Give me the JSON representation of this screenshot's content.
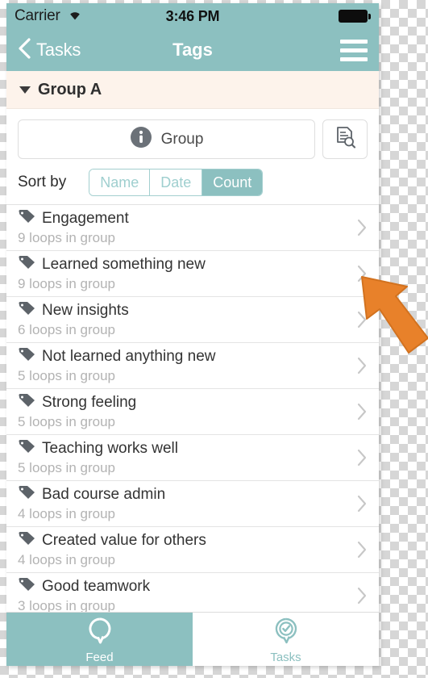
{
  "status_bar": {
    "carrier": "Carrier",
    "wifi_icon": "wifi-icon",
    "time": "3:46 PM",
    "battery_icon": "battery-full-icon"
  },
  "nav_bar": {
    "back_icon": "chevron-left-icon",
    "back_label": "Tasks",
    "title": "Tags",
    "menu_icon": "hamburger-menu-icon"
  },
  "group_header": {
    "disclosure_icon": "triangle-down-icon",
    "label": "Group A",
    "background_color": "#fdf3eb"
  },
  "actions": {
    "group_button": {
      "icon": "info-circle-icon",
      "label": "Group"
    },
    "doc_search_button": {
      "icon": "document-search-icon"
    }
  },
  "sort": {
    "label": "Sort by",
    "options": [
      "Name",
      "Date",
      "Count"
    ],
    "selected": "Count"
  },
  "tags": [
    {
      "icon": "tag-icon",
      "title": "Engagement",
      "subtitle": "9 loops in group",
      "chevron": "chevron-right-icon"
    },
    {
      "icon": "tag-icon",
      "title": "Learned something new",
      "subtitle": "9 loops in group",
      "chevron": "chevron-right-icon"
    },
    {
      "icon": "tag-icon",
      "title": "New insights",
      "subtitle": "6 loops in group",
      "chevron": "chevron-right-icon"
    },
    {
      "icon": "tag-icon",
      "title": "Not learned anything new",
      "subtitle": "5 loops in group",
      "chevron": "chevron-right-icon"
    },
    {
      "icon": "tag-icon",
      "title": "Strong feeling",
      "subtitle": "5 loops in group",
      "chevron": "chevron-right-icon"
    },
    {
      "icon": "tag-icon",
      "title": "Teaching works well",
      "subtitle": "5 loops in group",
      "chevron": "chevron-right-icon"
    },
    {
      "icon": "tag-icon",
      "title": "Bad course admin",
      "subtitle": "4 loops in group",
      "chevron": "chevron-right-icon"
    },
    {
      "icon": "tag-icon",
      "title": "Created value for others",
      "subtitle": "4 loops in group",
      "chevron": "chevron-right-icon"
    },
    {
      "icon": "tag-icon",
      "title": "Good teamwork",
      "subtitle": "3 loops in group",
      "chevron": "chevron-right-icon"
    }
  ],
  "tab_bar": {
    "tabs": [
      {
        "label": "Feed",
        "icon": "loop-bubble-icon",
        "active": true
      },
      {
        "label": "Tasks",
        "icon": "check-bubble-icon",
        "active": false
      }
    ]
  },
  "overlay": {
    "pointer_icon": "arrow-cursor-icon",
    "pointer_color": "#e8812a"
  },
  "theme": {
    "accent_teal": "#8cc0c0",
    "header_cream": "#fdf3eb",
    "text_dark": "#333333",
    "text_muted": "#b3b3b3"
  }
}
